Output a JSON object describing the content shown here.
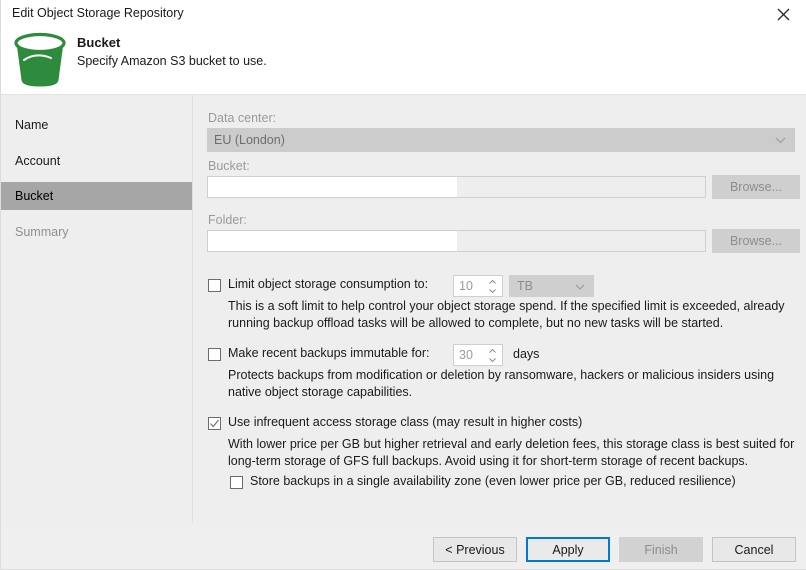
{
  "window": {
    "title": "Edit Object Storage Repository",
    "close_icon": "close-icon"
  },
  "header": {
    "icon": "bucket-icon",
    "title": "Bucket",
    "subtitle": "Specify Amazon S3 bucket to use.",
    "icon_color": "#2e8b3d"
  },
  "sidebar": {
    "items": [
      {
        "label": "Name",
        "state": "normal"
      },
      {
        "label": "Account",
        "state": "normal"
      },
      {
        "label": "Bucket",
        "state": "selected"
      },
      {
        "label": "Summary",
        "state": "disabled"
      }
    ],
    "selected_background": "#a6a6a6"
  },
  "form": {
    "data_center": {
      "label": "Data center:",
      "value": "EU (London)",
      "enabled": false,
      "arrow_icon": "chevron-down-icon"
    },
    "bucket": {
      "label": "Bucket:",
      "value": "",
      "browse_label": "Browse...",
      "browse_enabled": false
    },
    "folder": {
      "label": "Folder:",
      "value": "",
      "browse_label": "Browse...",
      "browse_enabled": false
    },
    "limit_consumption": {
      "checked": false,
      "label": "Limit object storage consumption to:",
      "amount": "10",
      "unit": "TB",
      "description": "This is a soft limit to help control your object storage spend. If the specified limit is exceeded, already running backup offload tasks will be allowed to complete, but no new tasks will be started."
    },
    "immutability": {
      "checked": false,
      "label": "Make recent backups immutable for:",
      "days": "30",
      "days_unit": "days",
      "description": "Protects backups from modification or deletion by ransomware, hackers or malicious insiders using native object storage capabilities."
    },
    "infrequent_access": {
      "checked": true,
      "label": "Use infrequent access storage class (may result in higher costs)",
      "description": "With lower price per GB but higher retrieval and early deletion fees, this storage class is best suited for long-term storage of GFS full backups. Avoid using it for short-term storage of recent backups.",
      "single_zone": {
        "checked": false,
        "label": "Store backups in a single availability zone (even lower price per GB, reduced resilience)"
      }
    }
  },
  "footer": {
    "previous_label": "< Previous",
    "apply_label": "Apply",
    "finish_label": "Finish",
    "cancel_label": "Cancel",
    "focus_color": "#0078d7"
  }
}
